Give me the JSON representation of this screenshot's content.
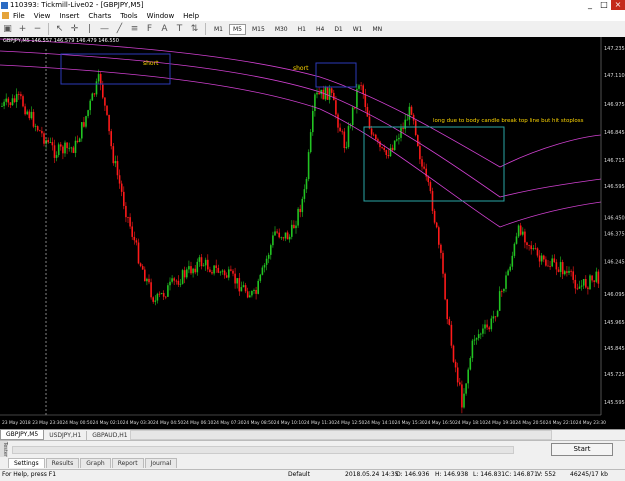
{
  "window": {
    "title": "110393: Tickmill-Live02 - [GBPJPY,M5]",
    "controls": [
      "_",
      "□",
      "×"
    ]
  },
  "menu": [
    "File",
    "View",
    "Insert",
    "Charts",
    "Tools",
    "Window",
    "Help"
  ],
  "timeframes": [
    "M1",
    "M5",
    "M15",
    "M30",
    "H1",
    "H4",
    "D1",
    "W1",
    "MN"
  ],
  "active_timeframe": "M5",
  "chart": {
    "symbol_line": "GBPJPY,M5  146.557 146.579 146.479 146.550",
    "annotations": {
      "short1": "short",
      "short2": "short",
      "long_note": "long due to body candle break top line but hit stoploss"
    },
    "price_labels": [
      "147.235",
      "147.110",
      "146.975",
      "146.845",
      "146.715",
      "146.595",
      "146.450",
      "146.375",
      "146.245",
      "146.095",
      "145.965",
      "145.845",
      "145.725",
      "145.595"
    ],
    "time_labels": [
      "23 May 2018",
      "23 May 23:30",
      "24 May 00:50",
      "24 May 02:10",
      "24 May 03:30",
      "24 May 04:50",
      "24 May 06:10",
      "24 May 07:30",
      "24 May 08:50",
      "24 May 10:10",
      "24 May 11:30",
      "24 May 12:50",
      "24 May 14:10",
      "24 May 15:30",
      "24 May 16:50",
      "24 May 18:10",
      "24 May 19:30",
      "24 May 20:50",
      "24 May 22:10",
      "24 May 23:30"
    ],
    "colors": {
      "bull": "#22c422",
      "bear": "#ff1a1a",
      "envelope": "#d040d0",
      "box_blue": "#2b3ab8",
      "box_teal": "#2aa6a6",
      "text_yellow": "#ffd700"
    }
  },
  "chart_tabs": [
    "GBPJPY,M5",
    "USDJPY,H1",
    "GBPAUD,H1"
  ],
  "active_chart_tab": "GBPJPY,M5",
  "tester": {
    "side_label": "Tester",
    "start": "Start"
  },
  "bottom_tabs": [
    "Settings",
    "Results",
    "Graph",
    "Report",
    "Journal"
  ],
  "active_bottom_tab": "Settings",
  "status": {
    "help": "For Help, press F1",
    "profile": "Default",
    "datetime": "2018.05.24 14:35",
    "open": "O: 146.936",
    "high": "H: 146.938",
    "low": "L: 146.831",
    "close": "C: 146.871",
    "volume": "V: 552",
    "traffic": "46245/17 kb"
  }
}
